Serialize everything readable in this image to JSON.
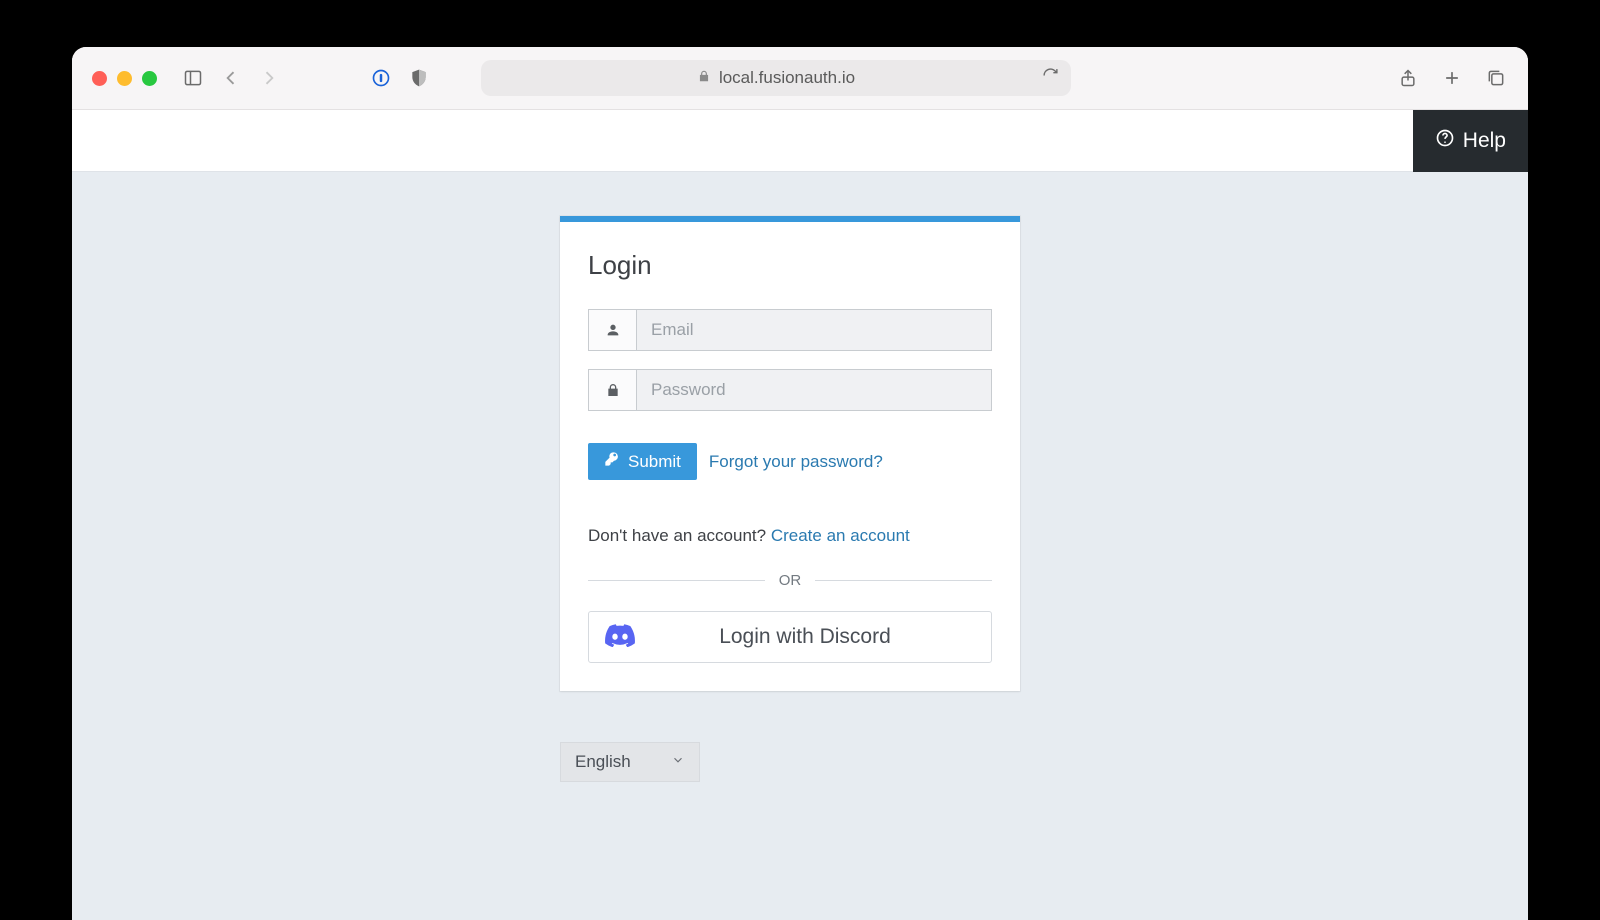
{
  "browser": {
    "url": "local.fusionauth.io"
  },
  "topbar": {
    "help_label": "Help"
  },
  "login": {
    "title": "Login",
    "email_placeholder": "Email",
    "password_placeholder": "Password",
    "submit_label": "Submit",
    "forgot_label": "Forgot your password?",
    "no_account_text": "Don't have an account? ",
    "create_account_label": "Create an account",
    "or_label": "OR",
    "sso": {
      "discord_label": "Login with Discord"
    }
  },
  "language": {
    "selected": "English"
  }
}
